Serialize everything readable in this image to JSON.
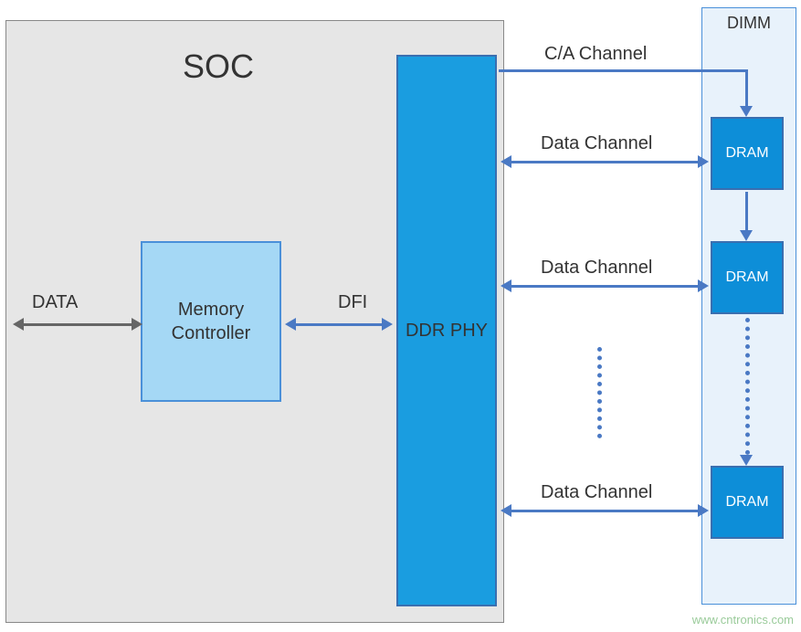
{
  "soc": {
    "title": "SOC"
  },
  "memory_controller": {
    "label": "Memory\nController"
  },
  "ddr_phy": {
    "label": "DDR PHY"
  },
  "dimm": {
    "title": "DIMM"
  },
  "dram": {
    "label1": "DRAM",
    "label2": "DRAM",
    "label3": "DRAM"
  },
  "labels": {
    "data": "DATA",
    "dfi": "DFI",
    "ca_channel": "C/A Channel",
    "data_channel1": "Data Channel",
    "data_channel2": "Data Channel",
    "data_channel3": "Data Channel"
  },
  "watermark": "www.cntronics.com",
  "chart_data": {
    "type": "table",
    "title": "SOC to DIMM memory interface block diagram",
    "blocks": [
      {
        "container": "SOC",
        "component": "Memory Controller"
      },
      {
        "container": "SOC",
        "component": "DDR PHY"
      },
      {
        "container": "DIMM",
        "component": "DRAM (multiple, chained via C/A)"
      }
    ],
    "connections": [
      {
        "from": "external",
        "to": "Memory Controller",
        "label": "DATA",
        "direction": "bidirectional"
      },
      {
        "from": "Memory Controller",
        "to": "DDR PHY",
        "label": "DFI",
        "direction": "bidirectional"
      },
      {
        "from": "DDR PHY",
        "to": "DIMM DRAM chain",
        "label": "C/A Channel",
        "direction": "unidirectional"
      },
      {
        "from": "DDR PHY",
        "to": "DRAM 1",
        "label": "Data Channel",
        "direction": "bidirectional"
      },
      {
        "from": "DDR PHY",
        "to": "DRAM 2",
        "label": "Data Channel",
        "direction": "bidirectional"
      },
      {
        "from": "DDR PHY",
        "to": "DRAM N",
        "label": "Data Channel",
        "direction": "bidirectional"
      }
    ]
  }
}
